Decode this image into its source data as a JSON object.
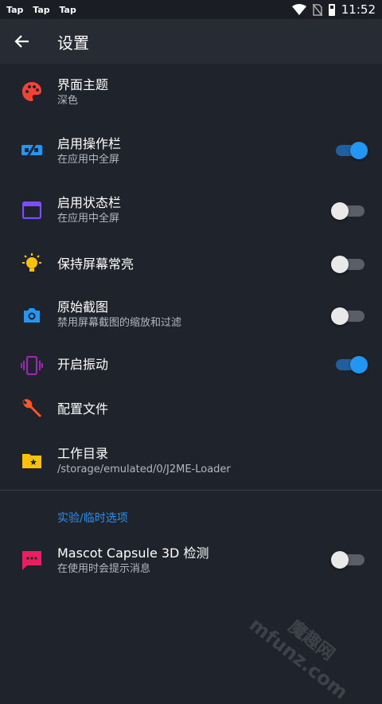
{
  "status_bar": {
    "taps": [
      "Tap",
      "Tap",
      "Tap"
    ],
    "time": "11:52"
  },
  "app_bar": {
    "title": "设置"
  },
  "settings": [
    {
      "title": "界面主题",
      "subtitle": "深色",
      "icon": "palette-icon"
    },
    {
      "title": "启用操作栏",
      "subtitle": "在应用中全屏",
      "icon": "keypad-icon",
      "toggle": true
    },
    {
      "title": "启用状态栏",
      "subtitle": "在应用中全屏",
      "icon": "window-icon",
      "toggle": false
    },
    {
      "title": "保持屏幕常亮",
      "subtitle": "",
      "icon": "bulb-icon",
      "toggle": false
    },
    {
      "title": "原始截图",
      "subtitle": "禁用屏幕截图的缩放和过滤",
      "icon": "camera-icon",
      "toggle": false
    },
    {
      "title": "开启振动",
      "subtitle": "",
      "icon": "vibration-icon",
      "toggle": true
    },
    {
      "title": "配置文件",
      "subtitle": "",
      "icon": "wrench-icon"
    },
    {
      "title": "工作目录",
      "subtitle": "/storage/emulated/0/J2ME-Loader",
      "icon": "folder-star-icon"
    }
  ],
  "section_header": "实验/临时选项",
  "experimental": [
    {
      "title": "Mascot Capsule 3D 检测",
      "subtitle": "在使用时会提示消息",
      "icon": "message-icon",
      "toggle": false
    }
  ],
  "watermark": {
    "line1": "魔趣网",
    "line2": "mfunz.com"
  },
  "colors": {
    "background": "#1f232b",
    "app_bar": "#272b34",
    "accent": "#2196f3",
    "section_header": "#2b8ff0"
  }
}
